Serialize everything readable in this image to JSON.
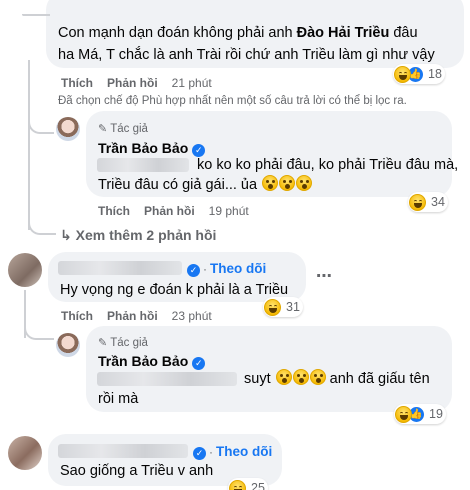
{
  "c1": {
    "line1_pre": "Con mạnh dạn đoán không phải anh ",
    "line1_bold": "Đào Hải Triều",
    "line1_post": " đâu",
    "line2": "ha Má, T chắc là anh Trài rồi chứ anh Triều làm gì như vậy",
    "like": "Thích",
    "reply": "Phản hồi",
    "time": "21 phút",
    "reaction_count": "18"
  },
  "filter_notice": "Đã chọn chế độ Phù hợp nhất nên một số câu trả lời có thể bị lọc ra.",
  "r1": {
    "tag": "Tác giả",
    "name": "Trần Bảo Bảo",
    "line1": "ko ko ko phải đâu, ko phải Triều đâu mà,",
    "line2": "Triều đâu có giả gái... ủa",
    "like": "Thích",
    "reply": "Phản hồi",
    "time": "19 phút",
    "reaction_count": "34"
  },
  "more_replies": "Xem thêm 2 phản hồi",
  "c2": {
    "follow": "Theo dõi",
    "text": "Hy vọng ng e đoán k phải là a Triều",
    "like": "Thích",
    "reply": "Phản hồi",
    "time": "23 phút",
    "reaction_count": "31"
  },
  "r2": {
    "tag": "Tác giả",
    "name": "Trần Bảo Bảo",
    "line1_word": "suyt",
    "line1_post": "anh đã giấu tên",
    "line2": "rồi mà",
    "reaction_count": "19"
  },
  "c3": {
    "follow": "Theo dõi",
    "text": "Sao giống a Triều v anh",
    "reaction_count": "25"
  },
  "icons": {
    "haha": "haha-reaction-icon",
    "like": "like-reaction-icon",
    "wow": "wow-emoji-icon",
    "verified": "verified-badge-icon",
    "more": "more-options-icon"
  },
  "colors": {
    "link": "#1877f2",
    "muted": "#65676b",
    "bubble": "#f0f2f5"
  }
}
